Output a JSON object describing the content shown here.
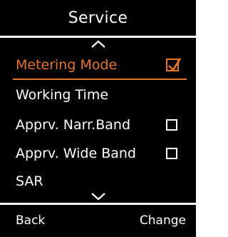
{
  "title": "Service",
  "menu": {
    "items": [
      {
        "label": "Metering Mode",
        "checkbox": true,
        "checked": true,
        "selected": true
      },
      {
        "label": "Working Time",
        "checkbox": false,
        "checked": false,
        "selected": false
      },
      {
        "label": "Apprv. Narr.Band",
        "checkbox": true,
        "checked": false,
        "selected": false
      },
      {
        "label": "Apprv. Wide Band",
        "checkbox": true,
        "checked": false,
        "selected": false
      },
      {
        "label": "SAR",
        "checkbox": false,
        "checked": false,
        "selected": false
      }
    ]
  },
  "icons": {
    "scroll_up": "chevron-up-icon",
    "scroll_down": "chevron-down-icon",
    "checked": "checkbox-checked-icon",
    "unchecked": "checkbox-empty-icon"
  },
  "softkeys": {
    "left": "Back",
    "right": "Change"
  },
  "colors": {
    "highlight": "#e8742a",
    "background": "#000000",
    "text": "#ffffff"
  }
}
